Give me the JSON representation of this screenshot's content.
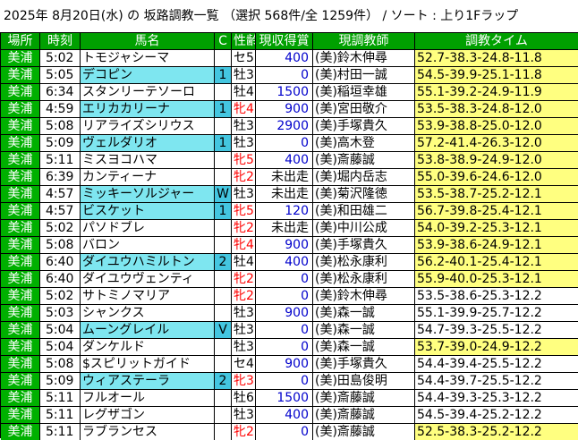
{
  "title": "2025年 8月20日(水) の 坂路調教一覧 （選択 568件/全 1259件） / ソート : 上り1Fラップ",
  "headers": {
    "place": "場所",
    "time": "時刻",
    "horse": "馬名",
    "c": "C",
    "sexage": "性齢",
    "prize": "現収得賞",
    "trainer": "現調教師",
    "training_time": "調教タイム"
  },
  "rows": [
    {
      "place": "美浦",
      "time": "5:02",
      "horse": "トモジャシーマ",
      "hl": false,
      "c": "",
      "sexage": "セ5",
      "sex": "m",
      "prize": "400",
      "trainer": "(美)鈴木伸尋",
      "tt": "52.7-38.3-24.8-11.8",
      "y": true
    },
    {
      "place": "美浦",
      "time": "5:05",
      "horse": "デコピン",
      "hl": true,
      "c": "1",
      "sexage": "牡3",
      "sex": "m",
      "prize": "0",
      "trainer": "(美)村田一誠",
      "tt": "54.5-39.9-25.1-11.8",
      "y": true
    },
    {
      "place": "美浦",
      "time": "6:34",
      "horse": "スタンリーテソーロ",
      "hl": false,
      "c": "",
      "sexage": "牡4",
      "sex": "m",
      "prize": "1500",
      "trainer": "(美)稲垣幸雄",
      "tt": "55.1-39.2-24.9-11.9",
      "y": true
    },
    {
      "place": "美浦",
      "time": "4:59",
      "horse": "エリカカリーナ",
      "hl": true,
      "c": "1",
      "sexage": "牝4",
      "sex": "f",
      "prize": "900",
      "trainer": "(美)宮田敬介",
      "tt": "53.5-38.3-24.8-12.0",
      "y": true
    },
    {
      "place": "美浦",
      "time": "5:08",
      "horse": "リアライズシリウス",
      "hl": false,
      "c": "",
      "sexage": "牡3",
      "sex": "m",
      "prize": "2900",
      "trainer": "(美)手塚貴久",
      "tt": "53.9-38.8-25.0-12.0",
      "y": true
    },
    {
      "place": "美浦",
      "time": "5:09",
      "horse": "ヴェルダリオ",
      "hl": true,
      "c": "1",
      "sexage": "牡3",
      "sex": "m",
      "prize": "0",
      "trainer": "(美)高木登",
      "tt": "57.2-41.4-26.3-12.0",
      "y": true
    },
    {
      "place": "美浦",
      "time": "5:11",
      "horse": "ミスヨコハマ",
      "hl": false,
      "c": "",
      "sexage": "牝5",
      "sex": "f",
      "prize": "400",
      "trainer": "(美)斎藤誠",
      "tt": "53.8-38.9-24.9-12.0",
      "y": true
    },
    {
      "place": "美浦",
      "time": "6:39",
      "horse": "カンティーナ",
      "hl": false,
      "c": "",
      "sexage": "牝2",
      "sex": "f",
      "prize": "未出走",
      "trainer": "(美)堀内岳志",
      "tt": "55.0-39.6-24.6-12.0",
      "y": true
    },
    {
      "place": "美浦",
      "time": "4:57",
      "horse": "ミッキーソルジャー",
      "hl": true,
      "c": "W",
      "sexage": "牡3",
      "sex": "m",
      "prize": "未出走",
      "trainer": "(美)菊沢隆徳",
      "tt": "53.5-38.7-25.2-12.1",
      "y": true
    },
    {
      "place": "美浦",
      "time": "4:57",
      "horse": "ビスケット",
      "hl": true,
      "c": "1",
      "sexage": "牝5",
      "sex": "f",
      "prize": "120",
      "trainer": "(美)和田雄二",
      "tt": "56.7-39.8-25.4-12.1",
      "y": true
    },
    {
      "place": "美浦",
      "time": "5:02",
      "horse": "パソドブレ",
      "hl": false,
      "c": "",
      "sexage": "牝2",
      "sex": "f",
      "prize": "未出走",
      "trainer": "(美)中川公成",
      "tt": "54.0-39.2-25.3-12.1",
      "y": true
    },
    {
      "place": "美浦",
      "time": "5:08",
      "horse": "バロン",
      "hl": false,
      "c": "",
      "sexage": "牝4",
      "sex": "f",
      "prize": "900",
      "trainer": "(美)手塚貴久",
      "tt": "53.9-38.6-24.9-12.1",
      "y": true
    },
    {
      "place": "美浦",
      "time": "6:40",
      "horse": "ダイユウハミルトン",
      "hl": true,
      "c": "2",
      "sexage": "牡4",
      "sex": "m",
      "prize": "400",
      "trainer": "(美)松永康利",
      "tt": "56.2-40.1-25.4-12.1",
      "y": true
    },
    {
      "place": "美浦",
      "time": "6:40",
      "horse": "ダイユウヴェンティ",
      "hl": false,
      "c": "",
      "sexage": "牝2",
      "sex": "f",
      "prize": "0",
      "trainer": "(美)松永康利",
      "tt": "55.9-40.0-25.3-12.1",
      "y": true
    },
    {
      "place": "美浦",
      "time": "5:02",
      "horse": "サトミノマリア",
      "hl": false,
      "c": "",
      "sexage": "牝2",
      "sex": "f",
      "prize": "0",
      "trainer": "(美)鈴木伸尋",
      "tt": "53.5-38.6-25.3-12.2",
      "y": false
    },
    {
      "place": "美浦",
      "time": "5:03",
      "horse": "シャンクス",
      "hl": false,
      "c": "",
      "sexage": "牡3",
      "sex": "m",
      "prize": "900",
      "trainer": "(美)森一誠",
      "tt": "55.1-39.9-25.7-12.2",
      "y": false
    },
    {
      "place": "美浦",
      "time": "5:04",
      "horse": "ムーングレイル",
      "hl": true,
      "c": "V",
      "sexage": "牡3",
      "sex": "m",
      "prize": "0",
      "trainer": "(美)森一誠",
      "tt": "54.7-39.3-25.5-12.2",
      "y": false
    },
    {
      "place": "美浦",
      "time": "5:04",
      "horse": "ダンケルド",
      "hl": false,
      "c": "",
      "sexage": "牡3",
      "sex": "m",
      "prize": "0",
      "trainer": "(美)森一誠",
      "tt": "53.7-39.0-24.9-12.2",
      "y": true
    },
    {
      "place": "美浦",
      "time": "5:08",
      "horse": "$スピリットガイド",
      "hl": false,
      "c": "",
      "sexage": "セ4",
      "sex": "m",
      "prize": "900",
      "trainer": "(美)手塚貴久",
      "tt": "54.4-39.4-25.5-12.2",
      "y": false
    },
    {
      "place": "美浦",
      "time": "5:09",
      "horse": "ウィアステーラ",
      "hl": true,
      "c": "2",
      "sexage": "牝3",
      "sex": "f",
      "prize": "0",
      "trainer": "(美)田島俊明",
      "tt": "54.4-39.7-25.5-12.2",
      "y": false
    },
    {
      "place": "美浦",
      "time": "5:11",
      "horse": "フルオール",
      "hl": false,
      "c": "",
      "sexage": "牡6",
      "sex": "m",
      "prize": "1500",
      "trainer": "(美)斎藤誠",
      "tt": "54.4-39.3-25.3-12.2",
      "y": false
    },
    {
      "place": "美浦",
      "time": "5:11",
      "horse": "レグザゴン",
      "hl": false,
      "c": "",
      "sexage": "牡3",
      "sex": "m",
      "prize": "400",
      "trainer": "(美)斎藤誠",
      "tt": "54.5-39.4-25.2-12.2",
      "y": false
    },
    {
      "place": "美浦",
      "time": "5:11",
      "horse": "ラブランセス",
      "hl": false,
      "c": "",
      "sexage": "牝2",
      "sex": "f",
      "prize": "0",
      "trainer": "(美)斎藤誠",
      "tt": "52.5-38.3-25.2-12.2",
      "y": true
    }
  ]
}
